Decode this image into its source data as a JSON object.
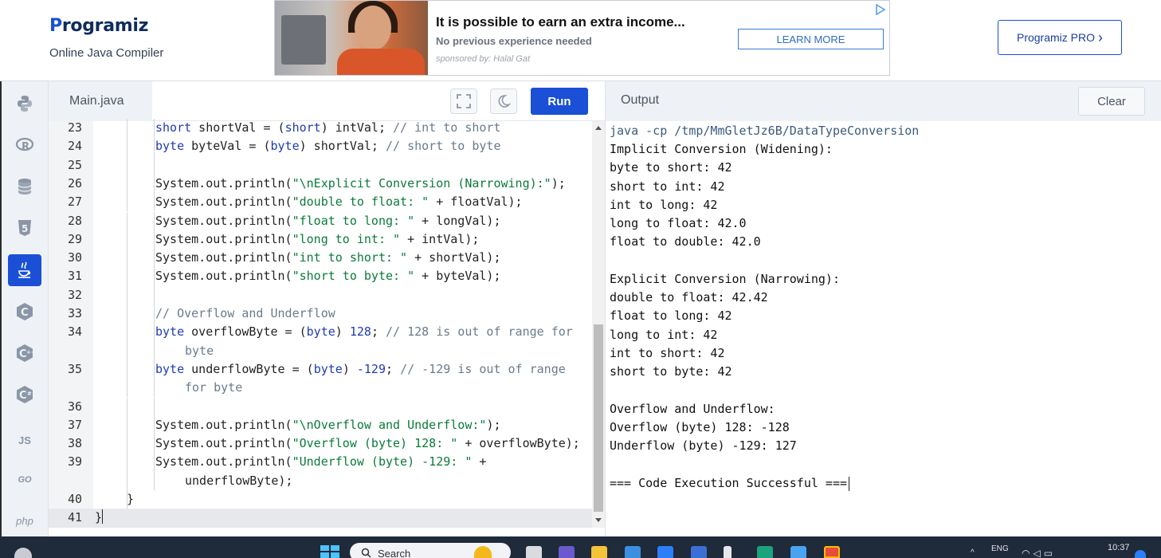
{
  "header": {
    "logo_text": "rogramiz",
    "logo_initial": "P",
    "subtitle": "Online Java Compiler",
    "pro_button": "Programiz PRO",
    "pro_chevron": "›"
  },
  "ad": {
    "title": "It is possible to earn an extra income...",
    "description": "No previous experience needed",
    "sponsor": "sponsored by: Halal Gat",
    "button": "LEARN MORE"
  },
  "sidebar": {
    "languages": [
      {
        "name": "python",
        "label": "",
        "active": false
      },
      {
        "name": "r",
        "label": "R",
        "active": false
      },
      {
        "name": "sql",
        "label": "",
        "active": false
      },
      {
        "name": "html",
        "label": "5",
        "active": false
      },
      {
        "name": "java",
        "label": "",
        "active": true
      },
      {
        "name": "c",
        "label": "C",
        "active": false
      },
      {
        "name": "cpp",
        "label": "C",
        "active": false
      },
      {
        "name": "csharp",
        "label": "C",
        "active": false
      },
      {
        "name": "javascript",
        "label": "JS",
        "active": false
      },
      {
        "name": "go",
        "label": "GO",
        "active": false
      },
      {
        "name": "php",
        "label": "php",
        "active": false
      }
    ]
  },
  "editor": {
    "tab": "Main.java",
    "run_label": "Run",
    "lines": [
      {
        "n": "23",
        "indent": 2,
        "parts": [
          [
            "kw",
            "short"
          ],
          [
            "t",
            " shortVal = ("
          ],
          [
            "kw",
            "short"
          ],
          [
            "t",
            ") intVal; "
          ],
          [
            "cm",
            "// int to short"
          ]
        ]
      },
      {
        "n": "24",
        "indent": 2,
        "parts": [
          [
            "kw",
            "byte"
          ],
          [
            "t",
            " byteVal = ("
          ],
          [
            "kw",
            "byte"
          ],
          [
            "t",
            ") shortVal; "
          ],
          [
            "cm",
            "// short to byte"
          ]
        ]
      },
      {
        "n": "25",
        "indent": 2,
        "parts": []
      },
      {
        "n": "26",
        "indent": 2,
        "parts": [
          [
            "t",
            "System.out.println("
          ],
          [
            "str",
            "\"\\nExplicit Conversion (Narrowing):\""
          ],
          [
            "t",
            ");"
          ]
        ]
      },
      {
        "n": "27",
        "indent": 2,
        "parts": [
          [
            "t",
            "System.out.println("
          ],
          [
            "str",
            "\"double to float: \""
          ],
          [
            "t",
            " + floatVal);"
          ]
        ]
      },
      {
        "n": "28",
        "indent": 2,
        "parts": [
          [
            "t",
            "System.out.println("
          ],
          [
            "str",
            "\"float to long: \""
          ],
          [
            "t",
            " + longVal);"
          ]
        ]
      },
      {
        "n": "29",
        "indent": 2,
        "parts": [
          [
            "t",
            "System.out.println("
          ],
          [
            "str",
            "\"long to int: \""
          ],
          [
            "t",
            " + intVal);"
          ]
        ]
      },
      {
        "n": "30",
        "indent": 2,
        "parts": [
          [
            "t",
            "System.out.println("
          ],
          [
            "str",
            "\"int to short: \""
          ],
          [
            "t",
            " + shortVal);"
          ]
        ]
      },
      {
        "n": "31",
        "indent": 2,
        "parts": [
          [
            "t",
            "System.out.println("
          ],
          [
            "str",
            "\"short to byte: \""
          ],
          [
            "t",
            " + byteVal);"
          ]
        ]
      },
      {
        "n": "32",
        "indent": 2,
        "parts": []
      },
      {
        "n": "33",
        "indent": 2,
        "parts": [
          [
            "cm",
            "// Overflow and Underflow"
          ]
        ]
      },
      {
        "n": "34",
        "indent": 2,
        "parts": [
          [
            "kw",
            "byte"
          ],
          [
            "t",
            " overflowByte = ("
          ],
          [
            "kw",
            "byte"
          ],
          [
            "t",
            ") "
          ],
          [
            "num",
            "128"
          ],
          [
            "t",
            "; "
          ],
          [
            "cm",
            "// 128 is out of range for"
          ]
        ]
      },
      {
        "n": "",
        "indent": 3,
        "parts": [
          [
            "cm",
            "byte"
          ]
        ]
      },
      {
        "n": "35",
        "indent": 2,
        "parts": [
          [
            "kw",
            "byte"
          ],
          [
            "t",
            " underflowByte = ("
          ],
          [
            "kw",
            "byte"
          ],
          [
            "t",
            ") "
          ],
          [
            "num",
            "-129"
          ],
          [
            "t",
            "; "
          ],
          [
            "cm",
            "// -129 is out of range"
          ]
        ]
      },
      {
        "n": "",
        "indent": 3,
        "parts": [
          [
            "cm",
            "for byte"
          ]
        ]
      },
      {
        "n": "36",
        "indent": 2,
        "parts": []
      },
      {
        "n": "37",
        "indent": 2,
        "parts": [
          [
            "t",
            "System.out.println("
          ],
          [
            "str",
            "\"\\nOverflow and Underflow:\""
          ],
          [
            "t",
            ");"
          ]
        ]
      },
      {
        "n": "38",
        "indent": 2,
        "parts": [
          [
            "t",
            "System.out.println("
          ],
          [
            "str",
            "\"Overflow (byte) 128: \""
          ],
          [
            "t",
            " + overflowByte);"
          ]
        ]
      },
      {
        "n": "39",
        "indent": 2,
        "parts": [
          [
            "t",
            "System.out.println("
          ],
          [
            "str",
            "\"Underflow (byte) -129: \""
          ],
          [
            "t",
            " +"
          ]
        ]
      },
      {
        "n": "",
        "indent": 3,
        "parts": [
          [
            "t",
            "underflowByte);"
          ]
        ]
      },
      {
        "n": "40",
        "indent": 1,
        "parts": [
          [
            "t",
            "}"
          ]
        ]
      },
      {
        "n": "41",
        "indent": 0,
        "parts": [
          [
            "t",
            "}"
          ]
        ],
        "active": true
      }
    ]
  },
  "output": {
    "title": "Output",
    "clear_label": "Clear",
    "command": "java -cp /tmp/MmGletJz6B/DataTypeConversion",
    "lines": [
      "Implicit Conversion (Widening):",
      "byte to short: 42",
      "short to int: 42",
      "int to long: 42",
      "long to float: 42.0",
      "float to double: 42.0",
      "",
      "Explicit Conversion (Narrowing):",
      "double to float: 42.42",
      "float to long: 42",
      "long to int: 42",
      "int to short: 42",
      "short to byte: 42",
      "",
      "Overflow and Underflow:",
      "Overflow (byte) 128: -128",
      "Underflow (byte) -129: 127",
      "",
      "=== Code Execution Successful ==="
    ]
  },
  "taskbar": {
    "search_label": "Search",
    "language": "ENG",
    "time": "10:37",
    "apps": [
      "file-explorer-icon",
      "browser-icon",
      "mail-icon",
      "store-icon",
      "edge-icon",
      "notepad-icon",
      "chrome-icon"
    ]
  },
  "colors": {
    "accent": "#1a4fd6",
    "keyword": "#1f3bb3",
    "string": "#0b7a3a",
    "comment": "#6b7b8c"
  }
}
